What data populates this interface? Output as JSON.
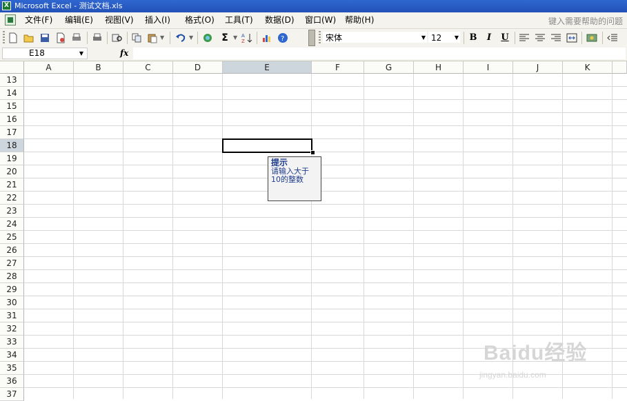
{
  "window": {
    "title": "Microsoft Excel - 测试文档.xls"
  },
  "menubar": {
    "items": [
      {
        "label": "文件(F)"
      },
      {
        "label": "编辑(E)"
      },
      {
        "label": "视图(V)"
      },
      {
        "label": "插入(I)"
      },
      {
        "label": "格式(O)"
      },
      {
        "label": "工具(T)"
      },
      {
        "label": "数据(D)"
      },
      {
        "label": "窗口(W)"
      },
      {
        "label": "帮助(H)"
      }
    ],
    "help_placeholder": "键入需要帮助的问题"
  },
  "toolbar": {
    "icons": [
      "new-icon",
      "open-icon",
      "save-icon",
      "permission-icon",
      "print-icon",
      "print-preview-icon",
      "research-icon",
      "copy-icon",
      "paste-icon",
      "undo-icon",
      "hyperlink-icon",
      "autosum-icon",
      "sort-ascending-icon",
      "chart-wizard-icon",
      "help-icon"
    ],
    "font_name": "宋体",
    "font_size": "12",
    "bold_label": "B",
    "italic_label": "I",
    "underline_label": "U"
  },
  "formula_bar": {
    "name_box": "E18",
    "fx_label": "fx",
    "formula": ""
  },
  "sheet": {
    "columns": [
      "A",
      "B",
      "C",
      "D",
      "E",
      "F",
      "G",
      "H",
      "I",
      "J",
      "K"
    ],
    "selected_column": "E",
    "rows": [
      "13",
      "14",
      "15",
      "16",
      "17",
      "18",
      "19",
      "20",
      "21",
      "22",
      "23",
      "24",
      "25",
      "26",
      "27",
      "28",
      "29",
      "30",
      "31",
      "32",
      "33",
      "34",
      "35",
      "36",
      "37"
    ],
    "selected_row": "18",
    "active_cell": "E18"
  },
  "input_message": {
    "title": "提示",
    "body": "请输入大于10的整数"
  },
  "watermark": {
    "main": "Baidu经验",
    "sub": "jingyan.baidu.com"
  }
}
